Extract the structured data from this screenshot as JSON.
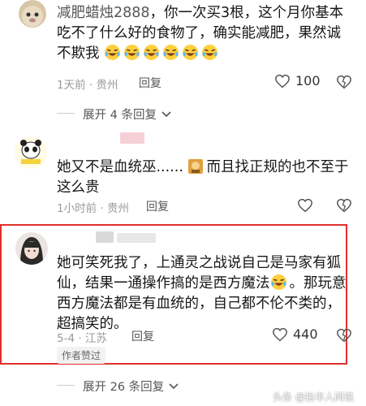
{
  "comments": [
    {
      "username": "减肥蜡烛2888",
      "text_line1_rest": "，你一次买3根，这个月你基本",
      "text_line2": "吃不了什么好的食物了，确实能减肥，果然诚",
      "text_line3": "不欺我",
      "time": "1天前 · 贵州",
      "reply_label": "回复",
      "likes": "100"
    },
    {
      "text_line1": "她又不是血统巫......",
      "text_line1_rest": "而且找正规的也不至于",
      "text_line2": "这么贵",
      "time": "1小时前 · 贵州",
      "reply_label": "回复"
    },
    {
      "text_line1": "她可笑死我了，上通灵之战说自己是马家有狐",
      "text_line2": "仙，结果一通操作搞的是西方魔法",
      "text_line2_rest": "。那玩意",
      "text_line3": "西方魔法都是有血统的，自己都不伦不类的，",
      "text_line4": "超搞笑的。",
      "time": "5-4 · 江苏",
      "reply_label": "回复",
      "likes": "440",
      "author_badge": "作者赞过"
    }
  ],
  "expand_replies_1": "展开 4 条回复",
  "expand_replies_2": "展开 26 条回复",
  "watermark": "头条 @抬丰人间说",
  "colors": {
    "highlight": "#e0302c",
    "emoji": "#ffcf3d"
  }
}
